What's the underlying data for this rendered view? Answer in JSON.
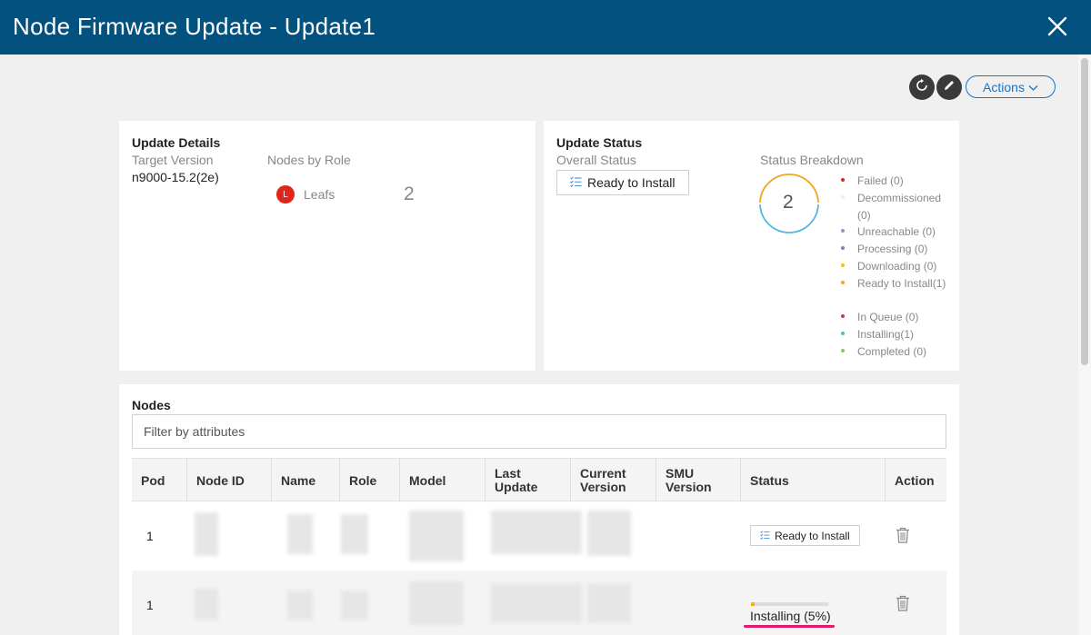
{
  "window": {
    "title": "Node Firmware Update - Update1"
  },
  "toolbar": {
    "actions_label": "Actions"
  },
  "details": {
    "title": "Update Details",
    "target_version_label": "Target Version",
    "target_version": "n9000-15.2(2e)",
    "nodes_by_role_label": "Nodes by Role",
    "role_badge": "L",
    "role_name": "Leafs",
    "role_count": "2"
  },
  "status": {
    "title": "Update Status",
    "overall_label": "Overall Status",
    "overall_value": "Ready to Install",
    "breakdown_label": "Status Breakdown",
    "donut_total": "2",
    "legend": [
      {
        "label": "Failed (0)",
        "color": "#e0261b"
      },
      {
        "label": "Decommissioned (0)",
        "color": "#eeeeee"
      },
      {
        "label": "Unreachable (0)",
        "color": "#9b8fc7"
      },
      {
        "label": "Processing (0)",
        "color": "#8a77b8"
      },
      {
        "label": "Downloading (0)",
        "color": "#f7c600"
      },
      {
        "label": "Ready to Install(1)",
        "color": "#f2a31b"
      },
      {
        "label": "In Queue (0)",
        "color": "#c7365f"
      },
      {
        "label": "Installing(1)",
        "color": "#4fb8e0"
      },
      {
        "label": "Completed (0)",
        "color": "#7ec86a"
      }
    ],
    "colors": {
      "ready": "#f2a31b",
      "installing": "#4fb8e0"
    }
  },
  "nodes": {
    "title": "Nodes",
    "filter_placeholder": "Filter by attributes",
    "columns": [
      "Pod",
      "Node ID",
      "Name",
      "Role",
      "Model",
      "Last Update",
      "Current Version",
      "SMU Version",
      "Status",
      "Action"
    ],
    "rows": [
      {
        "pod": "1",
        "status": "Ready to Install"
      },
      {
        "pod": "1",
        "status": "Installing (5%)",
        "progress": 0.05
      }
    ]
  }
}
